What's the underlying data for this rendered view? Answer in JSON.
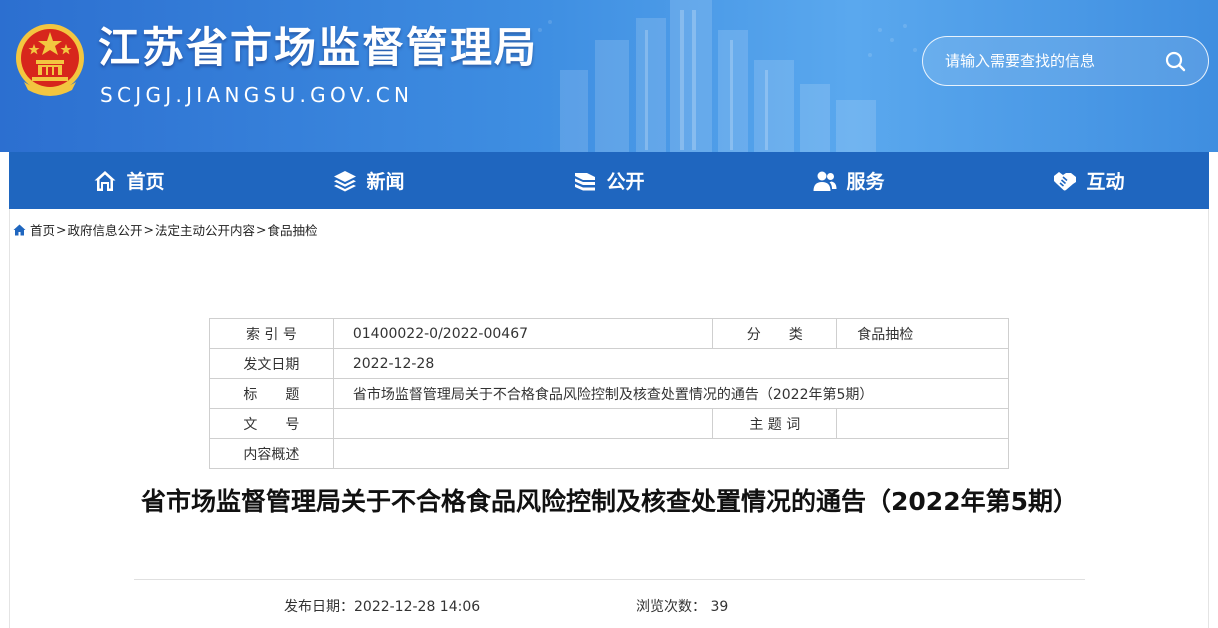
{
  "header": {
    "title": "江苏省市场监督管理局",
    "domain": "SCJGJ.JIANGSU.GOV.CN",
    "search_placeholder": "请输入需要查找的信息"
  },
  "nav": {
    "items": [
      {
        "label": "首页",
        "icon": "home-icon"
      },
      {
        "label": "新闻",
        "icon": "layers-icon"
      },
      {
        "label": "公开",
        "icon": "stack-icon"
      },
      {
        "label": "服务",
        "icon": "users-icon"
      },
      {
        "label": "互动",
        "icon": "handshake-icon"
      }
    ]
  },
  "breadcrumb": {
    "items": [
      "首页",
      "政府信息公开",
      "法定主动公开内容",
      "食品抽检"
    ],
    "separator": ">"
  },
  "meta": {
    "index_label": "索 引 号",
    "index_value": "01400022-0/2022-00467",
    "category_label": "分　　类",
    "category_value": "食品抽检",
    "date_label": "发文日期",
    "date_value": "2022-12-28",
    "title_label": "标　　题",
    "title_value": "省市场监督管理局关于不合格食品风险控制及核查处置情况的通告（2022年第5期）",
    "docno_label": "文　　号",
    "docno_value": "",
    "keywords_label": "主 题 词",
    "keywords_value": "",
    "summary_label": "内容概述",
    "summary_value": ""
  },
  "article": {
    "title": "省市场监督管理局关于不合格食品风险控制及核查处置情况的通告（2022年第5期）",
    "publish_label": "发布日期：",
    "publish_value": "2022-12-28 14:06",
    "views_label": "浏览次数：",
    "views_value": "39"
  },
  "colors": {
    "header_blue": "#3a86dd",
    "nav_blue": "#1f66bf",
    "emblem_red": "#d7261c",
    "emblem_gold": "#f3c640"
  }
}
